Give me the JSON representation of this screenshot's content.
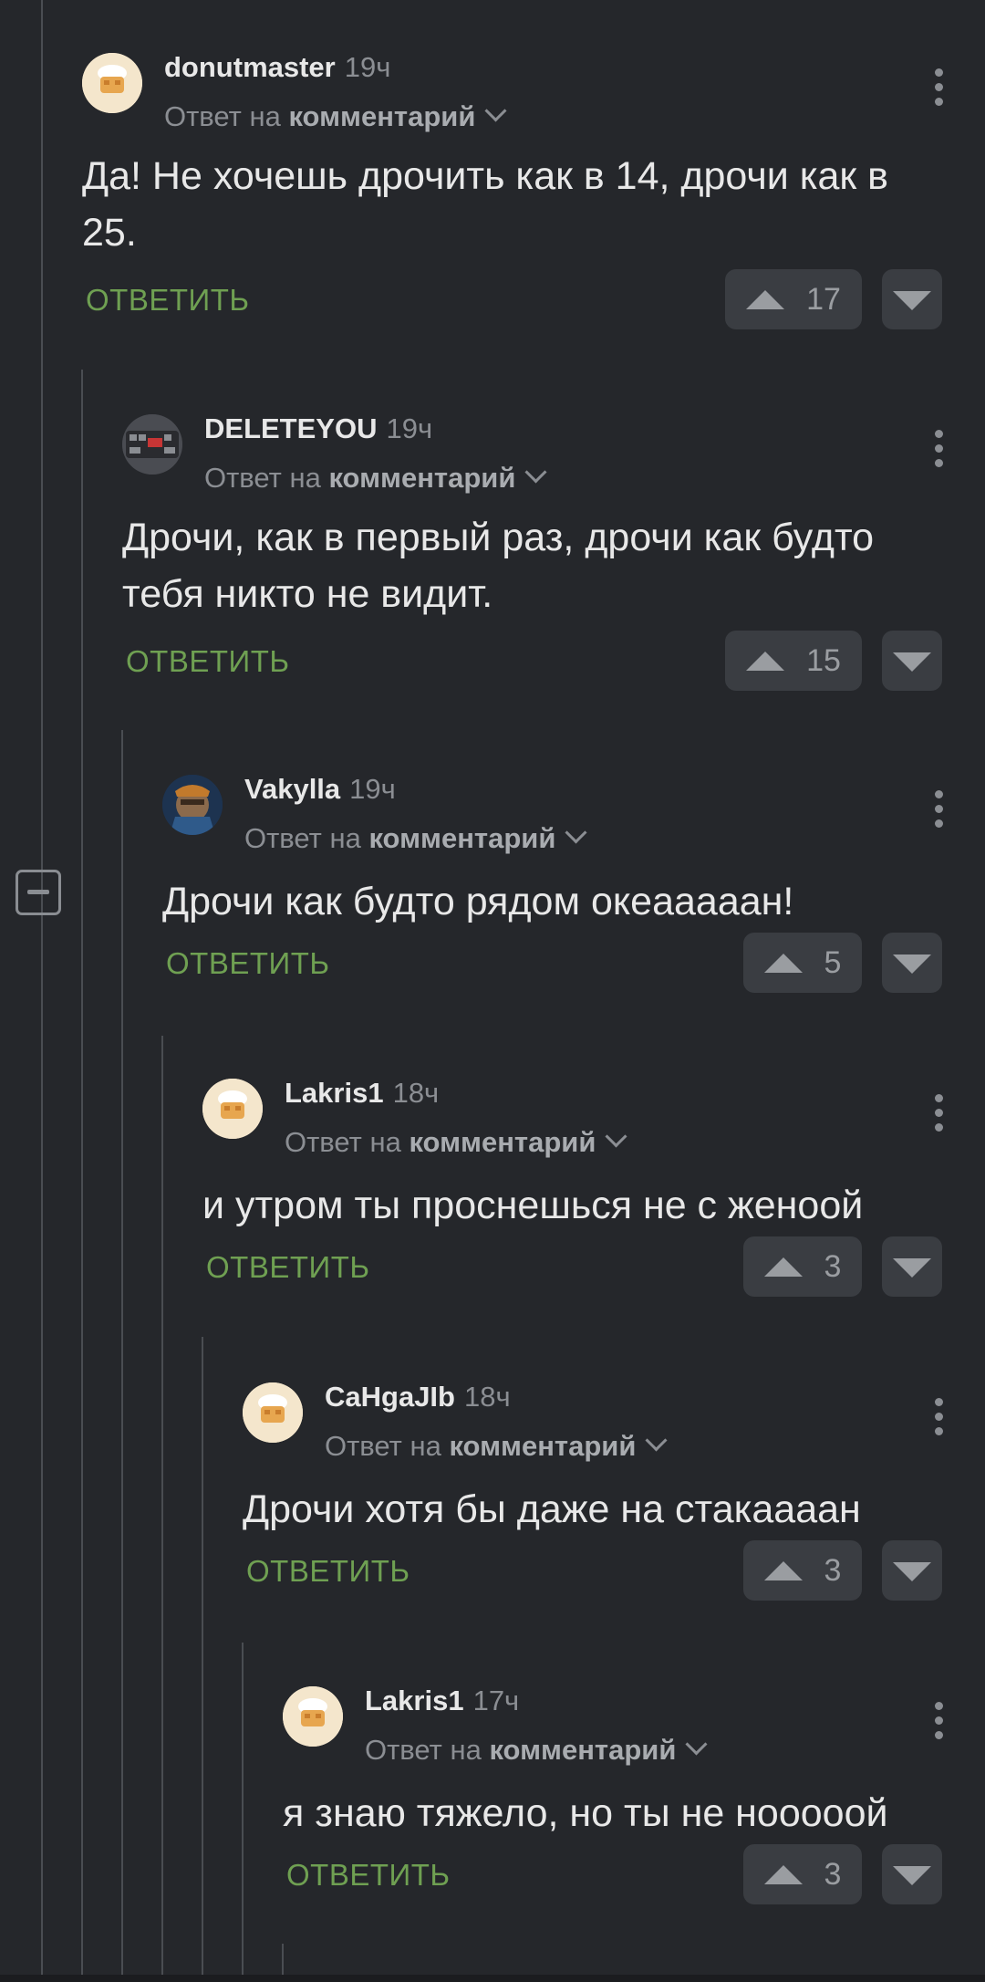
{
  "labels": {
    "reply_prefix": "Ответ на",
    "reply_target": "комментарий",
    "reply_button": "ОТВЕТИТЬ"
  },
  "colors": {
    "background": "#25272b",
    "reply_green": "#6fa052",
    "muted": "#8b8e93"
  },
  "comments": [
    {
      "author": "donutmaster",
      "time": "19ч",
      "text_lines": [
        "Да! Не хочешь дрочить как в 14, дрочи как в",
        "25."
      ],
      "score": "17",
      "avatar": "chef-hat-cake-avatar"
    },
    {
      "author": "DELETEYOU",
      "time": "19ч",
      "text_lines": [
        "Дрочи, как в первый раз, дрочи как будто",
        "тебя никто не видит."
      ],
      "score": "15",
      "avatar": "keyboard-avatar"
    },
    {
      "author": "Vakylla",
      "time": "19ч",
      "text_lines": [
        "Дрочи как будто рядом океааааан!"
      ],
      "score": "5",
      "avatar": "space-marine-avatar"
    },
    {
      "author": "Lakris1",
      "time": "18ч",
      "text_lines": [
        "и утром ты проснешься не с женоой"
      ],
      "score": "3",
      "avatar": "chef-hat-cake-avatar"
    },
    {
      "author": "CaHgaJIb",
      "time": "18ч",
      "text_lines": [
        "Дрочи хотя бы даже на стакаааан"
      ],
      "score": "3",
      "avatar": "chef-hat-cake-avatar"
    },
    {
      "author": "Lakris1",
      "time": "17ч",
      "text_lines": [
        "я знаю тяжело, но ты не нооооой"
      ],
      "score": "3",
      "avatar": "chef-hat-cake-avatar"
    }
  ]
}
